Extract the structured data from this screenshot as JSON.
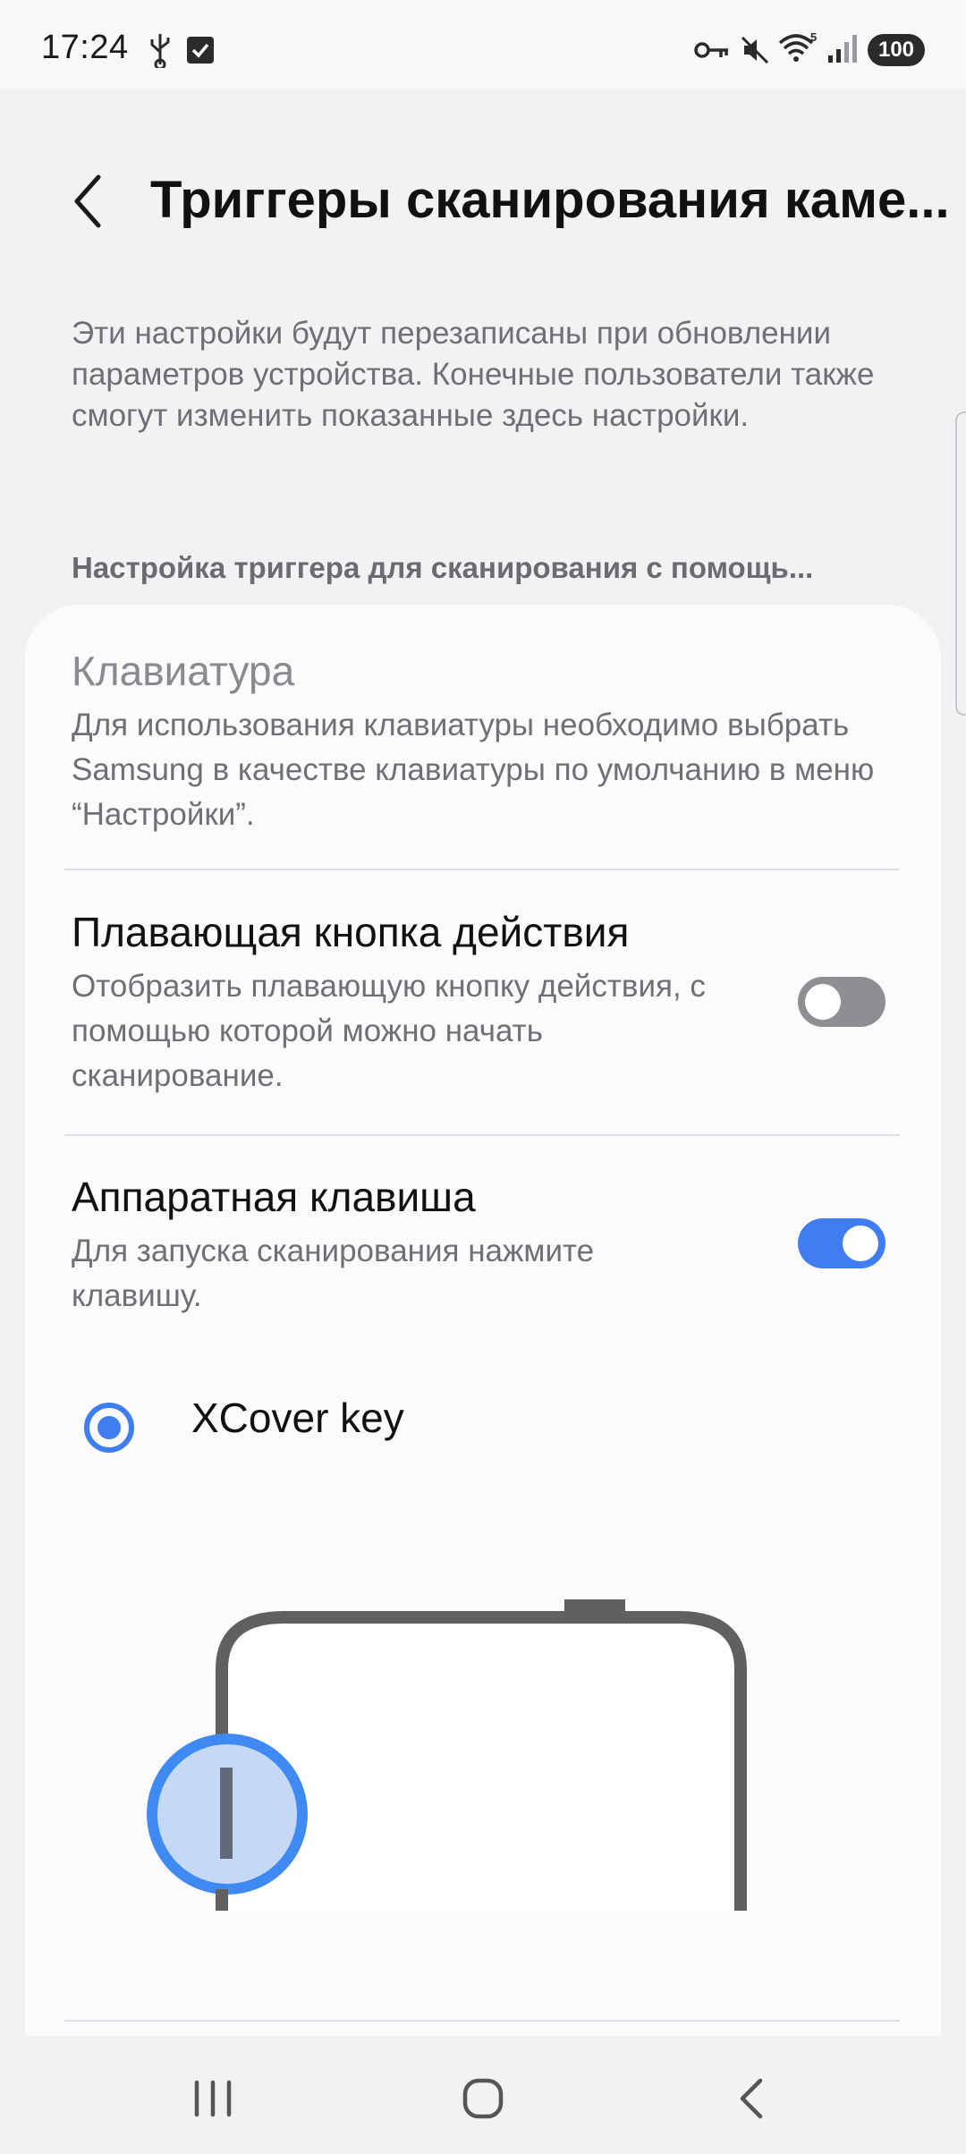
{
  "status_bar": {
    "time": "17:24",
    "battery": "100",
    "wifi_label": "5",
    "icons": [
      "usb-icon",
      "checkbox-notification-icon",
      "vpn-key-icon",
      "mute-icon",
      "wifi-icon",
      "signal-icon",
      "battery-icon"
    ]
  },
  "header": {
    "title": "Триггеры сканирования каме..."
  },
  "info_text": "Эти настройки будут перезаписаны при обновлении параметров устройства. Конечные пользователи также смогут изменить показанные здесь настройки.",
  "section_header": "Настройка триггера для сканирования с помощь...",
  "items": [
    {
      "title": "Клавиатура",
      "description": "Для использования клавиатуры необходимо выбрать Samsung в качестве клавиатуры по умолчанию в меню “Настройки”.",
      "enabled": false
    },
    {
      "title": "Плавающая кнопка действия",
      "description": "Отобразить плавающую кнопку действия, с помощью которой можно начать сканирование.",
      "toggle": false
    },
    {
      "title": "Аппаратная клавиша",
      "description": "Для запуска сканирования нажмите клавишу.",
      "toggle": true
    }
  ],
  "radio_option": {
    "label": "XCover key",
    "selected": true
  },
  "colors": {
    "accent": "#3f7df0",
    "background": "#f2f2f4",
    "card": "#fbfbfd",
    "secondary_text": "#707074"
  },
  "nav_bar": {
    "buttons": [
      "recents-icon",
      "home-icon",
      "back-icon"
    ]
  }
}
